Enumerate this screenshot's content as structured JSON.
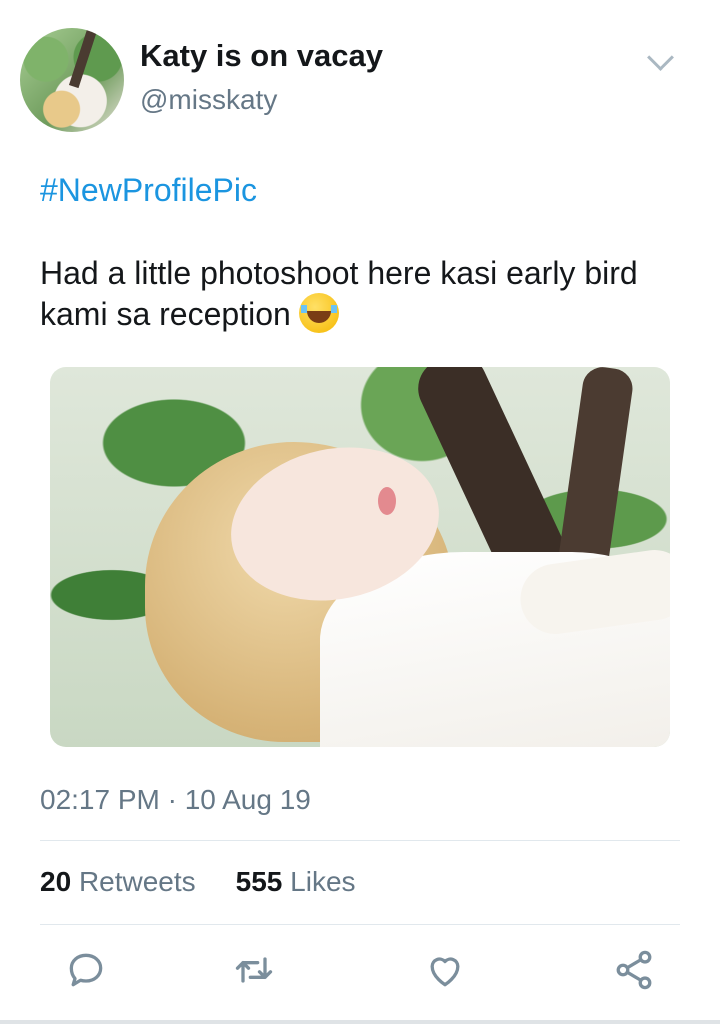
{
  "user": {
    "display_name": "Katy is on vacay",
    "handle": "@misskaty"
  },
  "tweet": {
    "hashtag": "#NewProfilePic",
    "text": "Had a little photoshoot here kasi early bird kami sa reception",
    "emoji": "face-with-tears-of-joy",
    "timestamp": "02:17 PM · 10 Aug 19"
  },
  "stats": {
    "retweets_count": "20",
    "retweets_label": "Retweets",
    "likes_count": "555",
    "likes_label": "Likes"
  },
  "icons": {
    "reply": "reply-icon",
    "retweet": "retweet-icon",
    "like": "heart-icon",
    "share": "share-icon",
    "menu": "chevron-down-icon"
  },
  "colors": {
    "link": "#1b95e0",
    "secondary_text": "#657786",
    "primary_text": "#14171a",
    "divider": "#e1e8ed"
  }
}
